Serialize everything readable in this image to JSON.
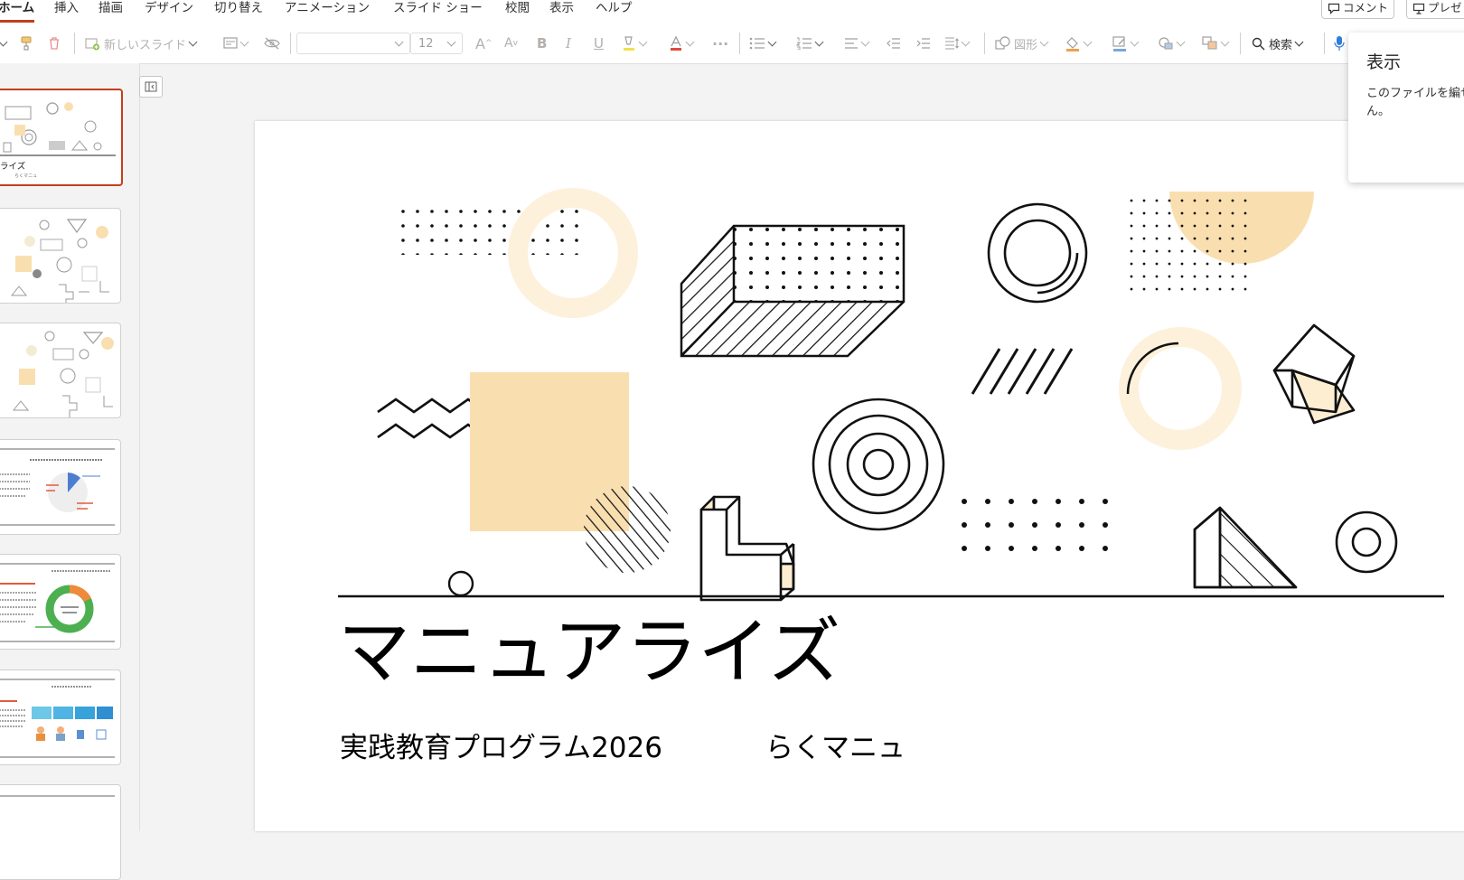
{
  "menu": {
    "tabs": [
      "ホーム",
      "挿入",
      "描画",
      "デザイン",
      "切り替え",
      "アニメーション",
      "スライド ショー",
      "校閲",
      "表示",
      "ヘルプ"
    ],
    "active_index": 0,
    "comment_label": "コメント",
    "present_label": "プレゼ"
  },
  "ribbon": {
    "new_slide_label": "新しいスライド",
    "font_size_value": "12",
    "bold_glyph": "B",
    "italic_glyph": "I",
    "underline_glyph": "U",
    "shapes_label": "図形",
    "search_label": "検索",
    "more_glyph": "···"
  },
  "thumbnails": {
    "selected_index": 0,
    "slide1_title": "ライズ",
    "slide1_sub": "らくマニュ"
  },
  "slide": {
    "title": "マニュアライズ",
    "subtitle_left": "実践教育プログラム2026",
    "subtitle_right": "らくマニュ",
    "accent_color": "#f9dfb0",
    "line_color": "#111111"
  },
  "info_panel": {
    "title": "表示",
    "body": "このファイルを編せん。"
  }
}
